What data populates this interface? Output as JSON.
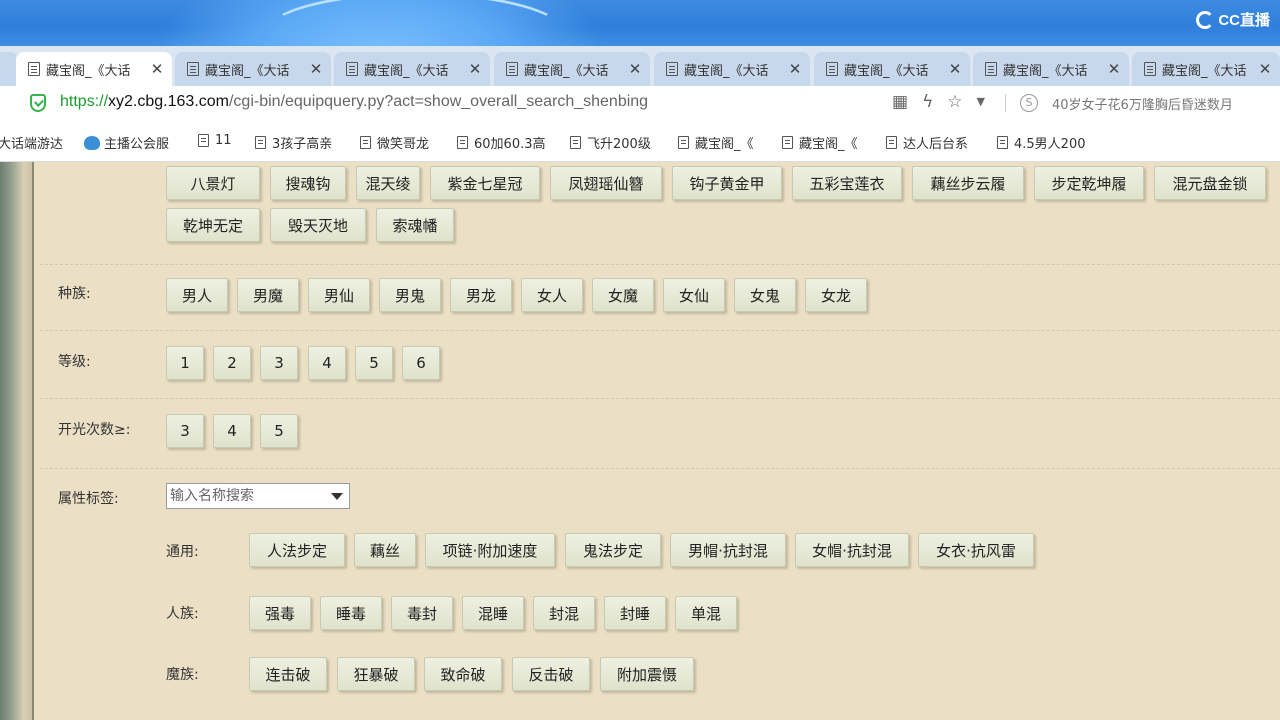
{
  "brand": {
    "name": "CC直播"
  },
  "tabs": [
    {
      "title": "藏宝阁_《大话"
    },
    {
      "title": "藏宝阁_《大话"
    },
    {
      "title": "藏宝阁_《大话"
    },
    {
      "title": "藏宝阁_《大话"
    },
    {
      "title": "藏宝阁_《大话"
    },
    {
      "title": "藏宝阁_《大话"
    },
    {
      "title": "藏宝阁_《大话"
    },
    {
      "title": "藏宝阁_《大话"
    }
  ],
  "address": {
    "protocol": "https://",
    "host": "xy2.cbg.163.com",
    "path": "/cgi-bin/equipquery.py?act=show_overall_search_shenbing",
    "search_hint": "40岁女子花6万隆胸后昏迷数月"
  },
  "bookmarks": [
    {
      "label": "大话端游达"
    },
    {
      "label": "主播公会服"
    },
    {
      "label": "11"
    },
    {
      "label": "3孩子高亲"
    },
    {
      "label": "微笑哥龙"
    },
    {
      "label": "60加60.3高"
    },
    {
      "label": "飞升200级"
    },
    {
      "label": "藏宝阁_《"
    },
    {
      "label": "藏宝阁_《"
    },
    {
      "label": "达人后台系"
    },
    {
      "label": "4.5男人200"
    }
  ],
  "weapons": {
    "row1": [
      "八景灯",
      "搜魂钩",
      "混天绫",
      "紫金七星冠",
      "凤翅瑶仙簪",
      "钩子黄金甲",
      "五彩宝莲衣",
      "藕丝步云履",
      "步定乾坤履",
      "混元盘金锁"
    ],
    "row2": [
      "乾坤无定",
      "毁天灭地",
      "索魂幡"
    ]
  },
  "race": {
    "label": "种族:",
    "options": [
      "男人",
      "男魔",
      "男仙",
      "男鬼",
      "男龙",
      "女人",
      "女魔",
      "女仙",
      "女鬼",
      "女龙"
    ]
  },
  "level": {
    "label": "等级:",
    "options": [
      "1",
      "2",
      "3",
      "4",
      "5",
      "6"
    ]
  },
  "kaiguang": {
    "label": "开光次数≥:",
    "options": [
      "3",
      "4",
      "5"
    ]
  },
  "attr": {
    "label": "属性标签:",
    "select_placeholder": "输入名称搜索",
    "general": {
      "label": "通用:",
      "options": [
        "人法步定",
        "藕丝",
        "项链·附加速度",
        "鬼法步定",
        "男帽·抗封混",
        "女帽·抗封混",
        "女衣·抗风雷"
      ]
    },
    "human": {
      "label": "人族:",
      "options": [
        "强毒",
        "睡毒",
        "毒封",
        "混睡",
        "封混",
        "封睡",
        "单混"
      ]
    },
    "demon": {
      "label": "魔族:",
      "options": [
        "连击破",
        "狂暴破",
        "致命破",
        "反击破",
        "附加震慑"
      ]
    }
  }
}
